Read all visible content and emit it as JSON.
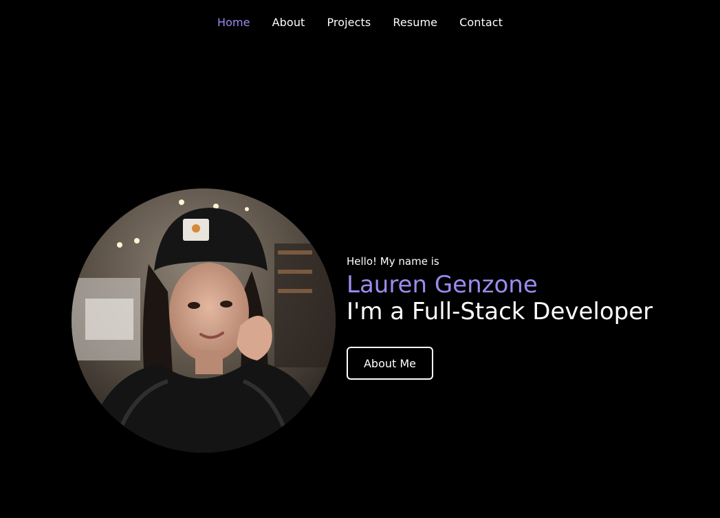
{
  "nav": {
    "items": [
      {
        "label": "Home",
        "active": true
      },
      {
        "label": "About",
        "active": false
      },
      {
        "label": "Projects",
        "active": false
      },
      {
        "label": "Resume",
        "active": false
      },
      {
        "label": "Contact",
        "active": false
      }
    ]
  },
  "hero": {
    "greeting": "Hello! My name is",
    "name": "Lauren Genzone",
    "role": "I'm a Full-Stack Developer",
    "cta_label": "About Me"
  },
  "colors": {
    "background": "#000000",
    "accent": "#9b8cf0",
    "text": "#ffffff"
  }
}
